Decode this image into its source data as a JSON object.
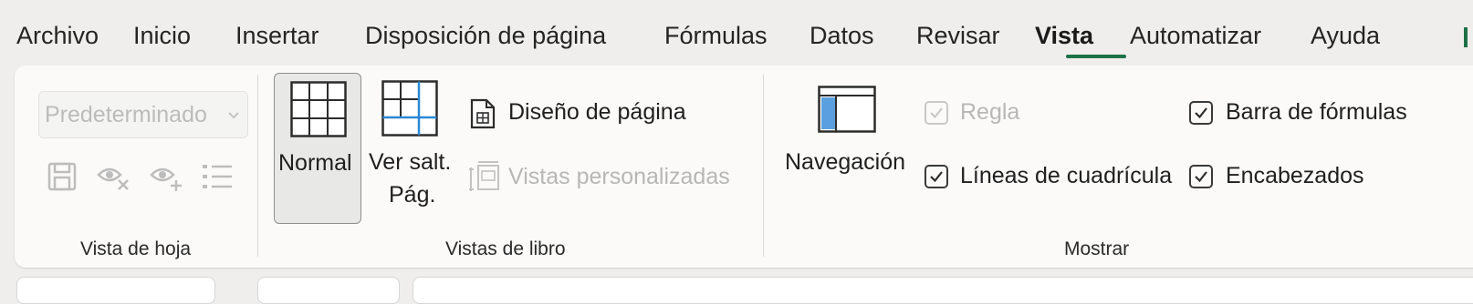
{
  "tabs": [
    {
      "label": "Archivo"
    },
    {
      "label": "Inicio"
    },
    {
      "label": "Insertar"
    },
    {
      "label": "Disposición de página"
    },
    {
      "label": "Fórmulas"
    },
    {
      "label": "Datos"
    },
    {
      "label": "Revisar"
    },
    {
      "label": "Vista"
    },
    {
      "label": "Automatizar"
    },
    {
      "label": "Ayuda"
    }
  ],
  "active_tab": "Vista",
  "accent_color": "#1e7145",
  "sheet_view": {
    "dropdown_value": "Predeterminado",
    "icons": [
      "save-icon",
      "hide-eye-icon",
      "new-view-eye-icon",
      "list-options-icon"
    ],
    "group_label": "Vista de hoja"
  },
  "workbook_views": {
    "normal_label": "Normal",
    "page_break_label_line1": "Ver salt.",
    "page_break_label_line2": "Pág.",
    "page_layout_label": "Diseño de página",
    "custom_views_label": "Vistas personalizadas",
    "group_label": "Vistas de libro"
  },
  "show": {
    "navigation_label": "Navegación",
    "ruler_label": "Regla",
    "ruler_checked": true,
    "ruler_enabled": false,
    "gridlines_label": "Líneas de cuadrícula",
    "gridlines_checked": true,
    "formula_bar_label": "Barra de fórmulas",
    "formula_bar_checked": true,
    "headings_label": "Encabezados",
    "headings_checked": true,
    "group_label": "Mostrar"
  }
}
